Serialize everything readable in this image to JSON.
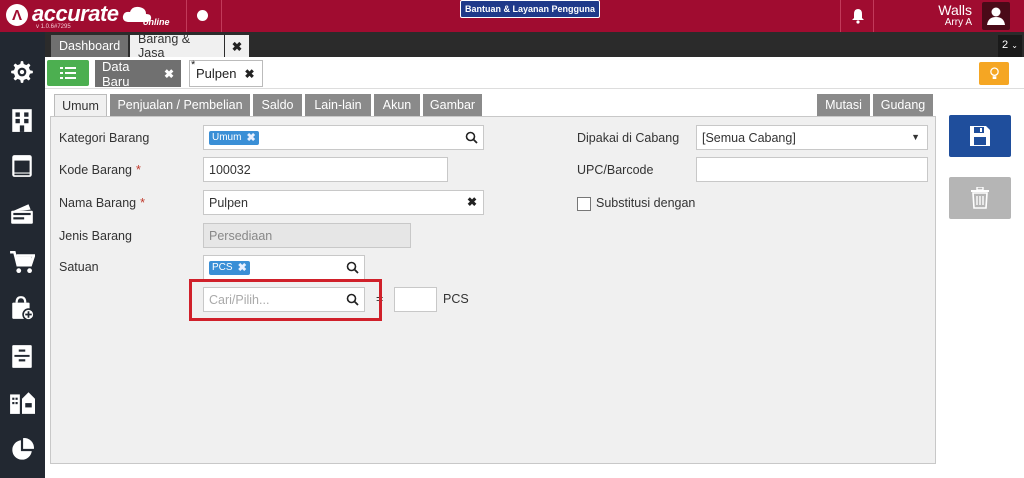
{
  "app": {
    "logo_text": "accurate",
    "logo_online": "online",
    "version": "v 1.0.6#7295",
    "help_button": "Bantuan & Layanan Pengguna",
    "user_name": "Walls",
    "user_sub": "Arry A",
    "brand_color": "#a00c30"
  },
  "modules": {
    "tabs": [
      {
        "label": "Dashboard"
      },
      {
        "label": "Barang & Jasa"
      }
    ],
    "close_label": "✖",
    "count": "2"
  },
  "sidebar": {
    "icons": [
      "settings-icon",
      "building-icon",
      "ledger-icon",
      "wallet-icon",
      "cart-icon",
      "shopping-bag-add-icon",
      "archive-icon",
      "company-icon",
      "pie-chart-icon"
    ]
  },
  "doc_tabs": {
    "items": [
      {
        "label": "Data Baru",
        "close": "✖"
      },
      {
        "label": "Pulpen",
        "close": "✖",
        "modified_marker": "*"
      }
    ]
  },
  "form_tabs": {
    "left": [
      "Umum",
      "Penjualan / Pembelian",
      "Saldo",
      "Lain-lain",
      "Akun",
      "Gambar"
    ],
    "right": [
      "Mutasi",
      "Gudang"
    ]
  },
  "form": {
    "kategori_label": "Kategori Barang",
    "kategori_tag": "Umum",
    "kode_label": "Kode Barang",
    "kode_value": "100032",
    "nama_label": "Nama Barang",
    "nama_value": "Pulpen",
    "jenis_label": "Jenis Barang",
    "jenis_value": "Persediaan",
    "satuan_label": "Satuan",
    "satuan_tag": "PCS",
    "cari_placeholder": "Cari/Pilih...",
    "equals": "=",
    "ratio_unit": "PCS",
    "required_marker": "*",
    "cabang_label": "Dipakai di Cabang",
    "cabang_value": "[Semua Cabang]",
    "upc_label": "UPC/Barcode",
    "upc_value": "",
    "substitusi_label": "Substitusi dengan",
    "tag_remove": "✖"
  }
}
